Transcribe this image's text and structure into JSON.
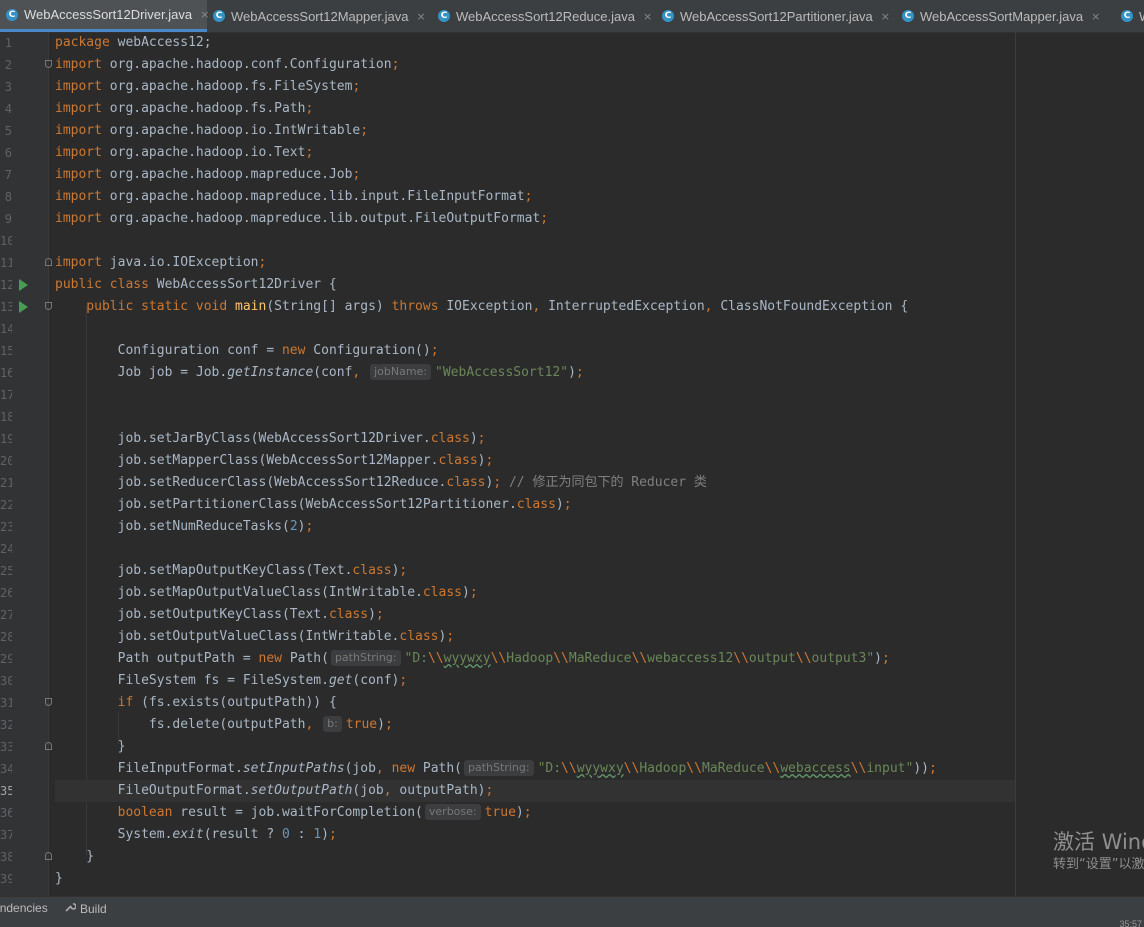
{
  "tabs": [
    {
      "label": "WebAccessSort12Driver.java",
      "active": true
    },
    {
      "label": "WebAccessSort12Mapper.java",
      "active": false
    },
    {
      "label": "WebAccessSort12Reduce.java",
      "active": false
    },
    {
      "label": "WebAccessSort12Partitioner.java",
      "active": false
    },
    {
      "label": "WebAccessSortMapper.java",
      "active": false
    },
    {
      "label": "W",
      "active": false
    }
  ],
  "tab_icon_letter": "C",
  "tab_close": "×",
  "lines": {
    "l1": {
      "num": "1",
      "tokens": [
        {
          "t": "package ",
          "c": "kw"
        },
        {
          "t": "webAccess12;",
          "c": ""
        }
      ]
    },
    "l2": {
      "num": "2",
      "tokens": [
        {
          "t": "import ",
          "c": "kw"
        },
        {
          "t": "org.apache.hadoop.conf.Configuration",
          "c": ""
        },
        {
          "t": ";",
          "c": "kw"
        }
      ]
    },
    "l3": {
      "num": "3",
      "tokens": [
        {
          "t": "import ",
          "c": "kw"
        },
        {
          "t": "org.apache.hadoop.fs.FileSystem",
          "c": ""
        },
        {
          "t": ";",
          "c": "kw"
        }
      ]
    },
    "l4": {
      "num": "4",
      "tokens": [
        {
          "t": "import ",
          "c": "kw"
        },
        {
          "t": "org.apache.hadoop.fs.Path",
          "c": ""
        },
        {
          "t": ";",
          "c": "kw"
        }
      ]
    },
    "l5": {
      "num": "5",
      "tokens": [
        {
          "t": "import ",
          "c": "kw"
        },
        {
          "t": "org.apache.hadoop.io.IntWritable",
          "c": ""
        },
        {
          "t": ";",
          "c": "kw"
        }
      ]
    },
    "l6": {
      "num": "6",
      "tokens": [
        {
          "t": "import ",
          "c": "kw"
        },
        {
          "t": "org.apache.hadoop.io.Text",
          "c": ""
        },
        {
          "t": ";",
          "c": "kw"
        }
      ]
    },
    "l7": {
      "num": "7",
      "tokens": [
        {
          "t": "import ",
          "c": "kw"
        },
        {
          "t": "org.apache.hadoop.mapreduce.Job",
          "c": ""
        },
        {
          "t": ";",
          "c": "kw"
        }
      ]
    },
    "l8": {
      "num": "8",
      "tokens": [
        {
          "t": "import ",
          "c": "kw"
        },
        {
          "t": "org.apache.hadoop.mapreduce.lib.input.FileInputFormat",
          "c": ""
        },
        {
          "t": ";",
          "c": "kw"
        }
      ]
    },
    "l9": {
      "num": "9",
      "tokens": [
        {
          "t": "import ",
          "c": "kw"
        },
        {
          "t": "org.apache.hadoop.mapreduce.lib.output.FileOutputFormat",
          "c": ""
        },
        {
          "t": ";",
          "c": "kw"
        }
      ]
    },
    "l10": {
      "num": "10",
      "tokens": []
    },
    "l11": {
      "num": "11",
      "tokens": [
        {
          "t": "import ",
          "c": "kw"
        },
        {
          "t": "java.io.IOException",
          "c": ""
        },
        {
          "t": ";",
          "c": "kw"
        }
      ]
    },
    "l12": {
      "num": "12",
      "tokens": [
        {
          "t": "public class ",
          "c": "kw"
        },
        {
          "t": "WebAccessSort12Driver {",
          "c": ""
        }
      ]
    },
    "l13": {
      "num": "13",
      "tokens": [
        {
          "t": "    public static void ",
          "c": "kw"
        },
        {
          "t": "main",
          "c": "fn"
        },
        {
          "t": "(String[] args) ",
          "c": ""
        },
        {
          "t": "throws ",
          "c": "kw"
        },
        {
          "t": "IOException",
          "c": ""
        },
        {
          "t": ", ",
          "c": "kw"
        },
        {
          "t": "InterruptedException",
          "c": ""
        },
        {
          "t": ", ",
          "c": "kw"
        },
        {
          "t": "ClassNotFoundException {",
          "c": ""
        }
      ]
    },
    "l14": {
      "num": "14",
      "tokens": []
    },
    "l15": {
      "num": "15",
      "tokens": [
        {
          "t": "        Configuration conf = ",
          "c": ""
        },
        {
          "t": "new ",
          "c": "kw"
        },
        {
          "t": "Configuration()",
          "c": ""
        },
        {
          "t": ";",
          "c": "kw"
        }
      ]
    },
    "l16": {
      "num": "16",
      "tokens": [
        {
          "t": "        Job job = Job.",
          "c": ""
        },
        {
          "t": "getInstance",
          "c": "it"
        },
        {
          "t": "(conf",
          "c": ""
        },
        {
          "t": ", ",
          "c": "kw"
        },
        {
          "t": "jobName:",
          "c": "hint"
        },
        {
          "t": "\"WebAccessSort12\"",
          "c": "str"
        },
        {
          "t": ")",
          "c": ""
        },
        {
          "t": ";",
          "c": "kw"
        }
      ]
    },
    "l17": {
      "num": "17",
      "tokens": []
    },
    "l18": {
      "num": "18",
      "tokens": []
    },
    "l19": {
      "num": "19",
      "tokens": [
        {
          "t": "        job.setJarByClass(WebAccessSort12Driver.",
          "c": ""
        },
        {
          "t": "class",
          "c": "kw"
        },
        {
          "t": ")",
          "c": ""
        },
        {
          "t": ";",
          "c": "kw"
        }
      ]
    },
    "l20": {
      "num": "20",
      "tokens": [
        {
          "t": "        job.setMapperClass(WebAccessSort12Mapper.",
          "c": ""
        },
        {
          "t": "class",
          "c": "kw"
        },
        {
          "t": ")",
          "c": ""
        },
        {
          "t": ";",
          "c": "kw"
        }
      ]
    },
    "l21": {
      "num": "21",
      "tokens": [
        {
          "t": "        job.setReducerClass(WebAccessSort12Reduce.",
          "c": ""
        },
        {
          "t": "class",
          "c": "kw"
        },
        {
          "t": ")",
          "c": ""
        },
        {
          "t": "; ",
          "c": "kw"
        },
        {
          "t": "// 修正为同包下的 Reducer 类",
          "c": "cmt"
        }
      ]
    },
    "l22": {
      "num": "22",
      "tokens": [
        {
          "t": "        job.setPartitionerClass(WebAccessSort12Partitioner.",
          "c": ""
        },
        {
          "t": "class",
          "c": "kw"
        },
        {
          "t": ")",
          "c": ""
        },
        {
          "t": ";",
          "c": "kw"
        }
      ]
    },
    "l23": {
      "num": "23",
      "tokens": [
        {
          "t": "        job.setNumReduceTasks(",
          "c": ""
        },
        {
          "t": "2",
          "c": "num"
        },
        {
          "t": ")",
          "c": ""
        },
        {
          "t": ";",
          "c": "kw"
        }
      ]
    },
    "l24": {
      "num": "24",
      "tokens": []
    },
    "l25": {
      "num": "25",
      "tokens": [
        {
          "t": "        job.setMapOutputKeyClass(Text.",
          "c": ""
        },
        {
          "t": "class",
          "c": "kw"
        },
        {
          "t": ")",
          "c": ""
        },
        {
          "t": ";",
          "c": "kw"
        }
      ]
    },
    "l26": {
      "num": "26",
      "tokens": [
        {
          "t": "        job.setMapOutputValueClass(IntWritable.",
          "c": ""
        },
        {
          "t": "class",
          "c": "kw"
        },
        {
          "t": ")",
          "c": ""
        },
        {
          "t": ";",
          "c": "kw"
        }
      ]
    },
    "l27": {
      "num": "27",
      "tokens": [
        {
          "t": "        job.setOutputKeyClass(Text.",
          "c": ""
        },
        {
          "t": "class",
          "c": "kw"
        },
        {
          "t": ")",
          "c": ""
        },
        {
          "t": ";",
          "c": "kw"
        }
      ]
    },
    "l28": {
      "num": "28",
      "tokens": [
        {
          "t": "        job.setOutputValueClass(IntWritable.",
          "c": ""
        },
        {
          "t": "class",
          "c": "kw"
        },
        {
          "t": ")",
          "c": ""
        },
        {
          "t": ";",
          "c": "kw"
        }
      ]
    },
    "l29": {
      "num": "29",
      "tokens": [
        {
          "t": "        Path outputPath = ",
          "c": ""
        },
        {
          "t": "new ",
          "c": "kw"
        },
        {
          "t": "Path(",
          "c": ""
        },
        {
          "t": "pathString:",
          "c": "hint"
        },
        {
          "t": "\"D:",
          "c": "str"
        },
        {
          "t": "\\\\",
          "c": "kw"
        },
        {
          "t": "wyywxy",
          "c": "str typo"
        },
        {
          "t": "\\\\",
          "c": "kw"
        },
        {
          "t": "Hadoop",
          "c": "str"
        },
        {
          "t": "\\\\",
          "c": "kw"
        },
        {
          "t": "MaReduce",
          "c": "str"
        },
        {
          "t": "\\\\",
          "c": "kw"
        },
        {
          "t": "webaccess12",
          "c": "str"
        },
        {
          "t": "\\\\",
          "c": "kw"
        },
        {
          "t": "output",
          "c": "str"
        },
        {
          "t": "\\\\",
          "c": "kw"
        },
        {
          "t": "output3\"",
          "c": "str"
        },
        {
          "t": ")",
          "c": ""
        },
        {
          "t": ";",
          "c": "kw"
        }
      ]
    },
    "l30": {
      "num": "30",
      "tokens": [
        {
          "t": "        FileSystem fs = FileSystem.",
          "c": ""
        },
        {
          "t": "get",
          "c": "it"
        },
        {
          "t": "(conf)",
          "c": ""
        },
        {
          "t": ";",
          "c": "kw"
        }
      ]
    },
    "l31": {
      "num": "31",
      "tokens": [
        {
          "t": "        ",
          "c": ""
        },
        {
          "t": "if ",
          "c": "kw"
        },
        {
          "t": "(fs.exists(outputPath)) {",
          "c": ""
        }
      ]
    },
    "l32": {
      "num": "32",
      "tokens": [
        {
          "t": "            fs.delete(outputPath",
          "c": ""
        },
        {
          "t": ", ",
          "c": "kw"
        },
        {
          "t": "b:",
          "c": "hint"
        },
        {
          "t": "true",
          "c": "kw"
        },
        {
          "t": ")",
          "c": ""
        },
        {
          "t": ";",
          "c": "kw"
        }
      ]
    },
    "l33": {
      "num": "33",
      "tokens": [
        {
          "t": "        }",
          "c": ""
        }
      ]
    },
    "l34": {
      "num": "34",
      "tokens": [
        {
          "t": "        FileInputFormat.",
          "c": ""
        },
        {
          "t": "setInputPaths",
          "c": "it"
        },
        {
          "t": "(job",
          "c": ""
        },
        {
          "t": ", ",
          "c": "kw"
        },
        {
          "t": "new ",
          "c": "kw"
        },
        {
          "t": "Path(",
          "c": ""
        },
        {
          "t": "pathString:",
          "c": "hint"
        },
        {
          "t": "\"D:",
          "c": "str"
        },
        {
          "t": "\\\\",
          "c": "kw"
        },
        {
          "t": "wyywxy",
          "c": "str typo"
        },
        {
          "t": "\\\\",
          "c": "kw"
        },
        {
          "t": "Hadoop",
          "c": "str"
        },
        {
          "t": "\\\\",
          "c": "kw"
        },
        {
          "t": "MaReduce",
          "c": "str"
        },
        {
          "t": "\\\\",
          "c": "kw"
        },
        {
          "t": "webaccess",
          "c": "str typo"
        },
        {
          "t": "\\\\",
          "c": "kw"
        },
        {
          "t": "input\"",
          "c": "str"
        },
        {
          "t": "))",
          "c": ""
        },
        {
          "t": ";",
          "c": "kw"
        }
      ]
    },
    "l35": {
      "num": "35",
      "tokens": [
        {
          "t": "        FileOutputFormat.",
          "c": ""
        },
        {
          "t": "setOutputPath",
          "c": "it"
        },
        {
          "t": "(job",
          "c": ""
        },
        {
          "t": ", ",
          "c": "kw"
        },
        {
          "t": "outputPath)",
          "c": ""
        },
        {
          "t": ";",
          "c": "kw"
        }
      ]
    },
    "l36": {
      "num": "36",
      "tokens": [
        {
          "t": "        ",
          "c": ""
        },
        {
          "t": "boolean ",
          "c": "kw"
        },
        {
          "t": "result = job.waitForCompletion(",
          "c": ""
        },
        {
          "t": "verbose:",
          "c": "hint"
        },
        {
          "t": "true",
          "c": "kw"
        },
        {
          "t": ")",
          "c": ""
        },
        {
          "t": ";",
          "c": "kw"
        }
      ]
    },
    "l37": {
      "num": "37",
      "tokens": [
        {
          "t": "        System.",
          "c": ""
        },
        {
          "t": "exit",
          "c": "it"
        },
        {
          "t": "(result ? ",
          "c": ""
        },
        {
          "t": "0",
          "c": "num"
        },
        {
          "t": " : ",
          "c": ""
        },
        {
          "t": "1",
          "c": "num"
        },
        {
          "t": ")",
          "c": ""
        },
        {
          "t": ";",
          "c": "kw"
        }
      ]
    },
    "l38": {
      "num": "38",
      "tokens": [
        {
          "t": "    }",
          "c": ""
        }
      ]
    },
    "l39": {
      "num": "39",
      "tokens": [
        {
          "t": "}",
          "c": ""
        }
      ]
    }
  },
  "watermark": {
    "line1": "激活 Windows",
    "line2": "转到“设置”以激活 Windows。"
  },
  "bottom": {
    "dependencies": "Dependencies",
    "build": "Build",
    "wrench_icon": "wrench-icon",
    "position": "35:57"
  },
  "colors": {
    "keyword": "#cc7832",
    "string": "#6a8759",
    "number": "#6897bb",
    "comment": "#808080",
    "method": "#ffc66d",
    "run_marker": "#499c54"
  }
}
